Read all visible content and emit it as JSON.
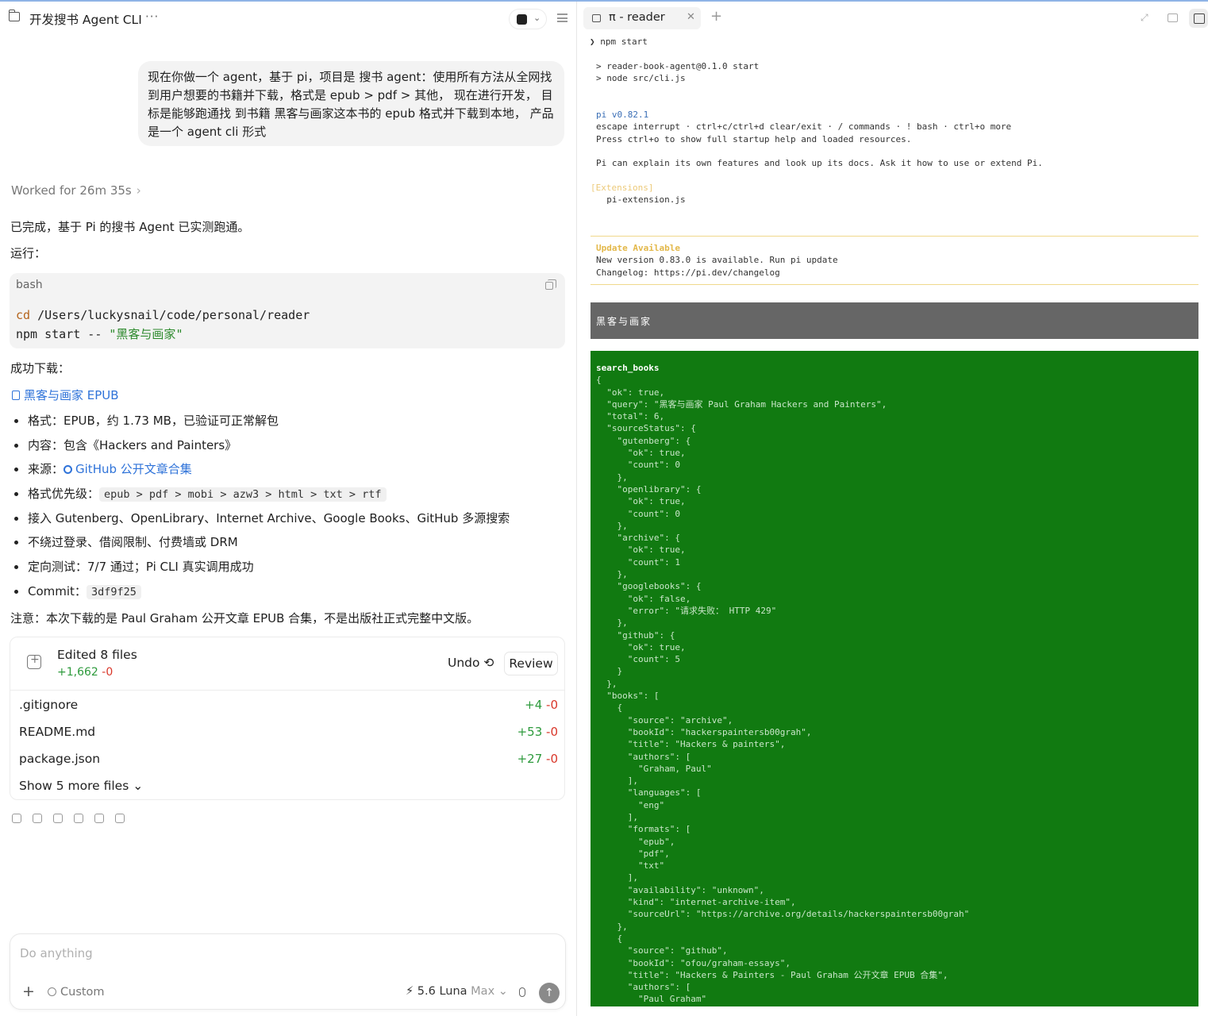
{
  "left": {
    "header": {
      "title": "开发搜书 Agent CLI",
      "more": "···"
    },
    "user_message": "现在你做一个 agent，基于 pi，项目是 搜书 agent：使用所有方法从全网找到用户想要的书籍并下载，格式是 epub > pdf > 其他， 现在进行开发， 目标是能够跑通找 到书籍 黑客与画家这本书的 epub 格式并下载到本地， 产品是一个 agent  cli 形式",
    "worked": "Worked for 26m 35s",
    "done_text": "已完成，基于 Pi 的搜书 Agent 已实测跑通。",
    "run_label": "运行：",
    "code": {
      "lang": "bash",
      "line1_kw": "cd",
      "line1_rest": " /Users/luckysnail/code/personal/reader",
      "line2_cmd": "npm start -- ",
      "line2_str": "\"黑客与画家\""
    },
    "success_label": "成功下载：",
    "download_link": "黑客与画家 EPUB",
    "bullets": {
      "format": "格式：EPUB，约 1.73 MB，已验证可正常解包",
      "content": "内容：包含《Hackers and Painters》",
      "source_prefix": "来源：",
      "source_link": "GitHub 公开文章合集",
      "priority_prefix": "格式优先级：",
      "priority_code": "epub > pdf > mobi > azw3 > html > txt > rtf",
      "sources": "接入 Gutenberg、OpenLibrary、Internet Archive、Google Books、GitHub 多源搜索",
      "no_bypass": "不绕过登录、借阅限制、付费墙或 DRM",
      "tests": "定向测试：7/7 通过；Pi CLI 真实调用成功",
      "commit_prefix": "Commit：",
      "commit_hash": "3df9f25"
    },
    "note": "注意：本次下载的是 Paul Graham 公开文章 EPUB 合集，不是出版社正式完整中文版。",
    "edits": {
      "title": "Edited 8 files",
      "add": "+1,662",
      "del": "-0",
      "undo": "Undo ⟲",
      "review": "Review",
      "files": [
        {
          "name": ".gitignore",
          "add": "+4",
          "del": "-0"
        },
        {
          "name": "README.md",
          "add": "+53",
          "del": "-0"
        },
        {
          "name": "package.json",
          "add": "+27",
          "del": "-0"
        }
      ],
      "show_more": "Show 5 more files ⌄"
    },
    "composer": {
      "placeholder": "Do anything",
      "custom": "Custom",
      "model": "5.6 Luna",
      "model_tier": "Max ⌄"
    }
  },
  "right": {
    "tab_title": "π - reader",
    "terminal": {
      "prompt": "❯ npm start",
      "l1": "> reader-book-agent@0.1.0 start",
      "l2": "> node src/cli.js",
      "pi_version": "pi v0.82.1",
      "help1": "escape interrupt · ctrl+c/ctrl+d clear/exit · / commands · ! bash · ctrl+o more",
      "help2": "Press ctrl+o to show full startup help and loaded resources.",
      "explain": "Pi can explain its own features and look up its docs. Ask it how to use or extend Pi.",
      "ext_label": "[Extensions]",
      "ext_file": "  pi-extension.js",
      "update_title": "Update Available",
      "update_line": "New version 0.83.0 is available. Run pi update",
      "changelog": "Changelog: https://pi.dev/changelog",
      "query_bar": "黑客与画家",
      "tool_name": "search_books",
      "json_output": "{\n  \"ok\": true,\n  \"query\": \"黑客与画家 Paul Graham Hackers and Painters\",\n  \"total\": 6,\n  \"sourceStatus\": {\n    \"gutenberg\": {\n      \"ok\": true,\n      \"count\": 0\n    },\n    \"openlibrary\": {\n      \"ok\": true,\n      \"count\": 0\n    },\n    \"archive\": {\n      \"ok\": true,\n      \"count\": 1\n    },\n    \"googlebooks\": {\n      \"ok\": false,\n      \"error\": \"请求失败： HTTP 429\"\n    },\n    \"github\": {\n      \"ok\": true,\n      \"count\": 5\n    }\n  },\n  \"books\": [\n    {\n      \"source\": \"archive\",\n      \"bookId\": \"hackerspaintersb00grah\",\n      \"title\": \"Hackers & painters\",\n      \"authors\": [\n        \"Graham, Paul\"\n      ],\n      \"languages\": [\n        \"eng\"\n      ],\n      \"formats\": [\n        \"epub\",\n        \"pdf\",\n        \"txt\"\n      ],\n      \"availability\": \"unknown\",\n      \"kind\": \"internet-archive-item\",\n      \"sourceUrl\": \"https://archive.org/details/hackerspaintersb00grah\"\n    },\n    {\n      \"source\": \"github\",\n      \"bookId\": \"ofou/graham-essays\",\n      \"title\": \"Hackers & Painters - Paul Graham 公开文章 EPUB 合集\",\n      \"authors\": [\n        \"Paul Graham\""
    }
  }
}
